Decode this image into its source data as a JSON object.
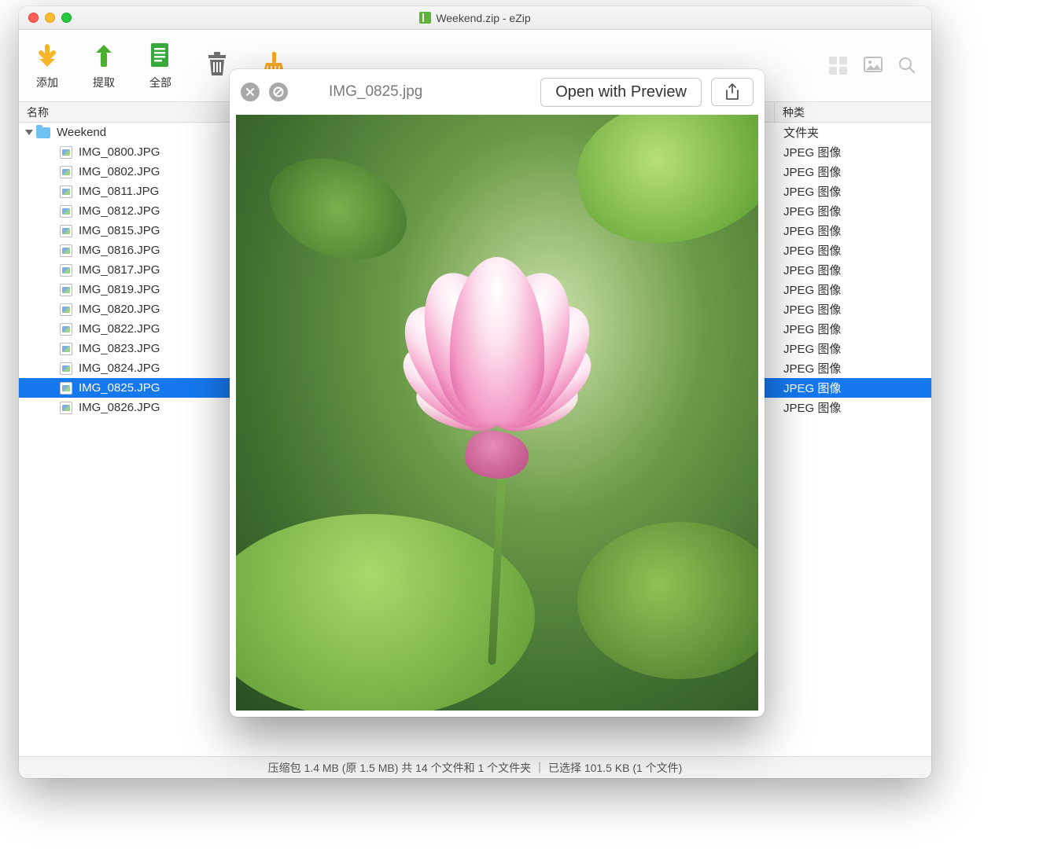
{
  "window": {
    "title": "Weekend.zip - eZip"
  },
  "toolbar": {
    "items": [
      {
        "id": "add",
        "label": "添加"
      },
      {
        "id": "extract",
        "label": "提取"
      },
      {
        "id": "extract-all",
        "label": "全部"
      },
      {
        "id": "delete",
        "label": ""
      },
      {
        "id": "clean",
        "label": ""
      }
    ]
  },
  "columns": {
    "name": "名称",
    "type": "种类"
  },
  "tree": {
    "folder": {
      "name": "Weekend",
      "type": "文件夹",
      "expanded": true
    },
    "files": [
      {
        "name": "IMG_0800.JPG",
        "type": "JPEG 图像"
      },
      {
        "name": "IMG_0802.JPG",
        "type": "JPEG 图像"
      },
      {
        "name": "IMG_0811.JPG",
        "type": "JPEG 图像"
      },
      {
        "name": "IMG_0812.JPG",
        "type": "JPEG 图像"
      },
      {
        "name": "IMG_0815.JPG",
        "type": "JPEG 图像"
      },
      {
        "name": "IMG_0816.JPG",
        "type": "JPEG 图像"
      },
      {
        "name": "IMG_0817.JPG",
        "type": "JPEG 图像"
      },
      {
        "name": "IMG_0819.JPG",
        "type": "JPEG 图像"
      },
      {
        "name": "IMG_0820.JPG",
        "type": "JPEG 图像"
      },
      {
        "name": "IMG_0822.JPG",
        "type": "JPEG 图像"
      },
      {
        "name": "IMG_0823.JPG",
        "type": "JPEG 图像"
      },
      {
        "name": "IMG_0824.JPG",
        "type": "JPEG 图像"
      },
      {
        "name": "IMG_0825.JPG",
        "type": "JPEG 图像",
        "selected": true
      },
      {
        "name": "IMG_0826.JPG",
        "type": "JPEG 图像"
      }
    ]
  },
  "status": "压缩包 1.4 MB (原 1.5 MB) 共 14 个文件和 1 个文件夹 ｜ 已选择 101.5 KB (1 个文件)",
  "preview": {
    "filename": "IMG_0825.jpg",
    "open_button": "Open with Preview"
  }
}
